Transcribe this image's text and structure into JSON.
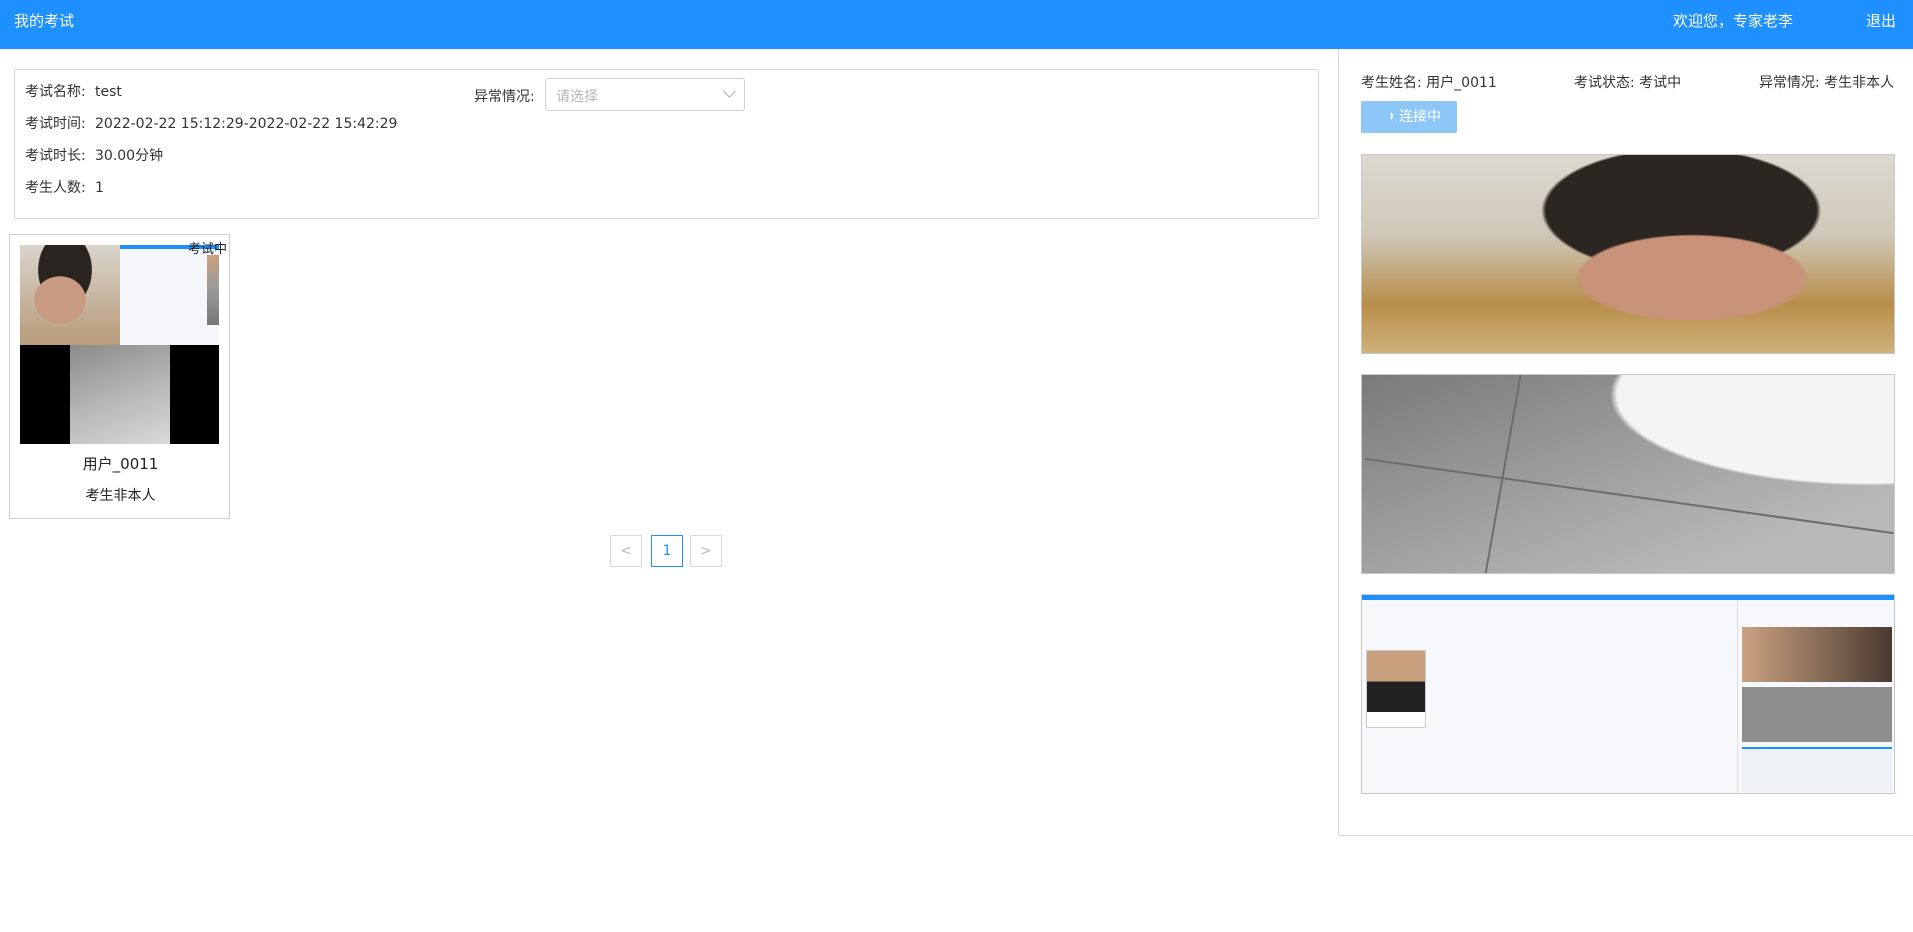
{
  "header": {
    "title": "我的考试",
    "welcome": "欢迎您，专家老李",
    "logout": "退出"
  },
  "exam_info": {
    "name_label": "考试名称:",
    "name_value": "test",
    "time_label": "考试时间:",
    "time_value": "2022-02-22 15:12:29-2022-02-22 15:42:29",
    "duration_label": "考试时长:",
    "duration_value": "30.00分钟",
    "count_label": "考生人数:",
    "count_value": "1",
    "abnormal_label": "异常情况:",
    "abnormal_placeholder": "请选择"
  },
  "cards": [
    {
      "status": "考试中",
      "name": "用户_0011",
      "abnormal": "考生非本人"
    }
  ],
  "pagination": {
    "prev": "<",
    "current": "1",
    "next": ">"
  },
  "detail": {
    "name_label": "考生姓名: 用户_0011",
    "status_label": "考试状态: 考试中",
    "abnormal_label": "异常情况: 考生非本人",
    "connect_button": "连接中"
  },
  "colors": {
    "brand": "#1e90ff",
    "connect_button": "#8cc7f7"
  }
}
